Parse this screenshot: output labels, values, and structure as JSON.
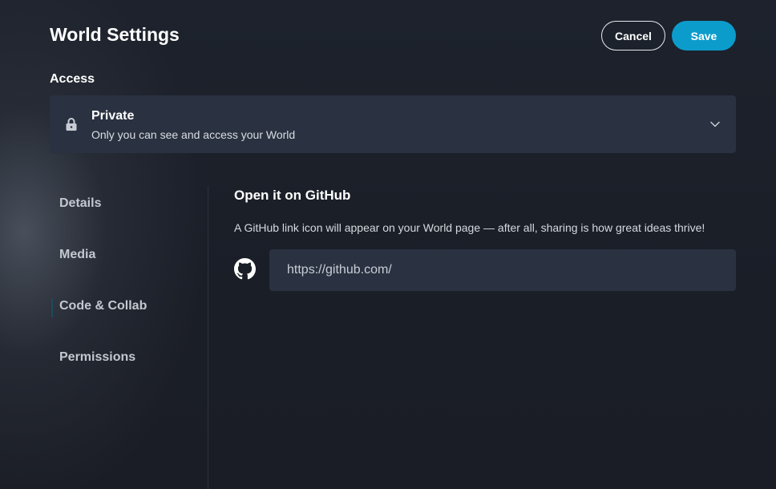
{
  "header": {
    "title": "World Settings",
    "cancel_label": "Cancel",
    "save_label": "Save"
  },
  "access": {
    "label": "Access",
    "selected_title": "Private",
    "selected_description": "Only you can see and access your World",
    "icon": "lock-icon"
  },
  "sidebar": {
    "items": [
      {
        "label": "Details"
      },
      {
        "label": "Media"
      },
      {
        "label": "Code & Collab",
        "active": true
      },
      {
        "label": "Permissions"
      }
    ]
  },
  "main": {
    "section_title": "Open it on GitHub",
    "section_description": "A GitHub link icon will appear on your World page — after all, sharing is how great ideas thrive!",
    "github_icon": "github-icon",
    "url_value": "https://github.com/"
  },
  "colors": {
    "accent": "#0c9ccc",
    "panel": "#2a3241",
    "background": "#1b1f28"
  }
}
